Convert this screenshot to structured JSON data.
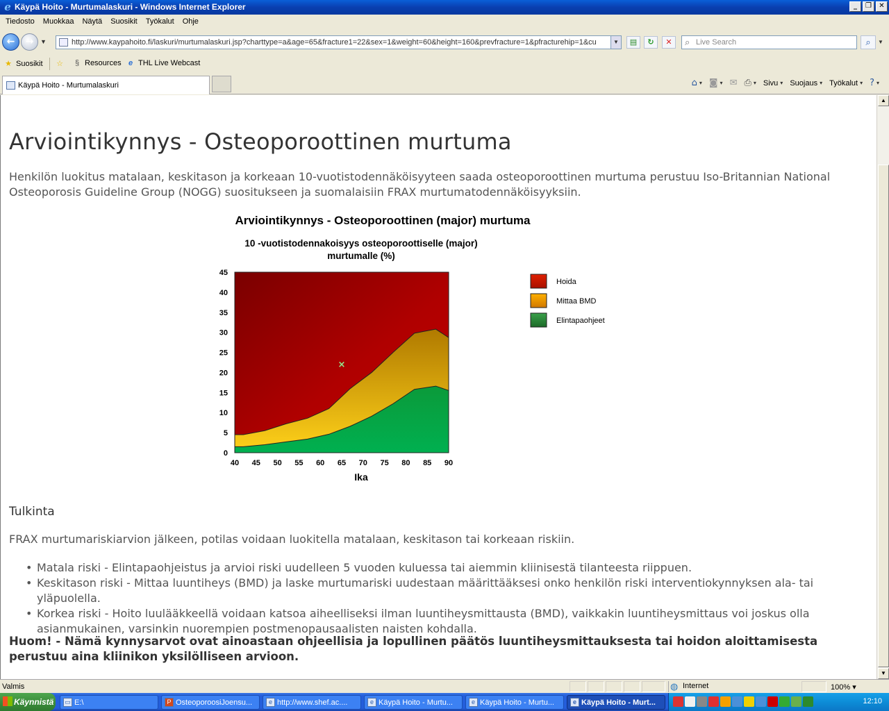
{
  "window": {
    "title": "Käypä Hoito - Murtumalaskuri - Windows Internet Explorer",
    "minimize_label": "_",
    "restore_label": "❐",
    "close_label": "✕"
  },
  "menu": [
    "Tiedosto",
    "Muokkaa",
    "Näytä",
    "Suosikit",
    "Työkalut",
    "Ohje"
  ],
  "address": {
    "url": "http://www.kaypahoito.fi/laskuri/murtumalaskuri.jsp?charttype=a&age=65&fracture1=22&sex=1&weight=60&height=160&prevfracture=1&pfracturehip=1&cu",
    "search_placeholder": "Live Search"
  },
  "favorites": {
    "label": "Suosikit",
    "items": [
      "Resources",
      "THL Live Webcast"
    ]
  },
  "tab": {
    "label": "Käypä Hoito - Murtumalaskuri"
  },
  "commandbar": {
    "page": "Sivu",
    "safety": "Suojaus",
    "tools": "Työkalut"
  },
  "page": {
    "title": "Arviointikynnys - Osteoporoottinen murtuma",
    "intro": "Henkilön luokitus matalaan, keskitason ja korkeaan 10-vuotistodennäköisyyteen saada osteoporoottinen murtuma perustuu Iso-Britannian National Osteoporosis Guideline Group (NOGG) suositukseen ja suomalaisiin FRAX murtumatodennäköisyyksiin.",
    "tulkinta_heading": "Tulkinta",
    "tulkinta_text": "FRAX murtumariskiarvion jälkeen, potilas voidaan luokitella matalaan, keskitason tai korkeaan riskiin.",
    "risks": [
      "Matala riski - Elintapaohjeistus ja arvioi riski uudelleen 5 vuoden kuluessa tai aiemmin kliinisestä tilanteesta riippuen.",
      "Keskitason riski - Mittaa luuntiheys (BMD) ja laske murtumariski uudestaan määrittääksesi onko henkilön riski interventiokynnyksen ala- tai yläpuolella.",
      "Korkea riski - Hoito luulääkkeellä voidaan katsoa aiheelliseksi ilman luuntiheysmittausta (BMD), vaikkakin luuntiheysmittaus voi joskus olla asianmukainen, varsinkin nuorempien postmenopausaalisten naisten kohdalla."
    ],
    "note": "Huom! - Nämä kynnysarvot ovat ainoastaan ohjeellisia ja lopullinen päätös luuntiheysmittauksesta tai hoidon aloittamisesta perustuu aina kliinikon yksilölliseen arvioon."
  },
  "chart_data": {
    "type": "area",
    "title": "Arviointikynnys - Osteoporoottinen (major) murtuma",
    "subtitle_lines": [
      "10 -vuotistodennakoisyys osteoporoottiselle (major)",
      "murtumalle (%)"
    ],
    "xlabel": "Ika",
    "xlim": [
      40,
      90
    ],
    "ylim": [
      0,
      45
    ],
    "xticks": [
      40,
      45,
      50,
      55,
      60,
      65,
      70,
      75,
      80,
      85,
      90
    ],
    "yticks": [
      0,
      5,
      10,
      15,
      20,
      25,
      30,
      35,
      40,
      45
    ],
    "x": [
      40,
      42,
      47,
      52,
      57,
      62,
      67,
      72,
      77,
      82,
      87,
      90
    ],
    "series": [
      {
        "name": "Elintapaohjeet",
        "color": "#1e8e3e",
        "values": [
          1.5,
          1.5,
          2.0,
          2.7,
          3.4,
          4.6,
          6.6,
          9.1,
          12.2,
          15.8,
          16.6,
          15.5
        ]
      },
      {
        "name": "Mittaa BMD",
        "color": "#e0a000",
        "values": [
          4.5,
          4.5,
          5.5,
          7.2,
          8.6,
          11.0,
          16.0,
          20.0,
          25.0,
          29.8,
          30.8,
          28.7
        ]
      },
      {
        "name": "Hoida",
        "color": "#b40000",
        "values": [
          45,
          45,
          45,
          45,
          45,
          45,
          45,
          45,
          45,
          45,
          45,
          45
        ]
      }
    ],
    "legend": [
      "Hoida",
      "Mittaa BMD",
      "Elintapaohjeet"
    ],
    "legend_colors": [
      "#c41a00",
      "#e89400",
      "#2e7d32"
    ],
    "legend_position": "right",
    "marker": {
      "x": 65,
      "y": 22,
      "symbol": "x",
      "color": "#90ee90"
    }
  },
  "status": {
    "text": "Valmis",
    "zone": "Internet",
    "zoom": "100%"
  },
  "taskbar": {
    "start": "Käynnistä",
    "tasks": [
      "E:\\",
      "OsteoporoosiJoensu...",
      "http://www.shef.ac....",
      "Käypä Hoito - Murtu...",
      "Käypä Hoito - Murtu...",
      "Käypä Hoito - Murt..."
    ],
    "clock": "12:10"
  }
}
